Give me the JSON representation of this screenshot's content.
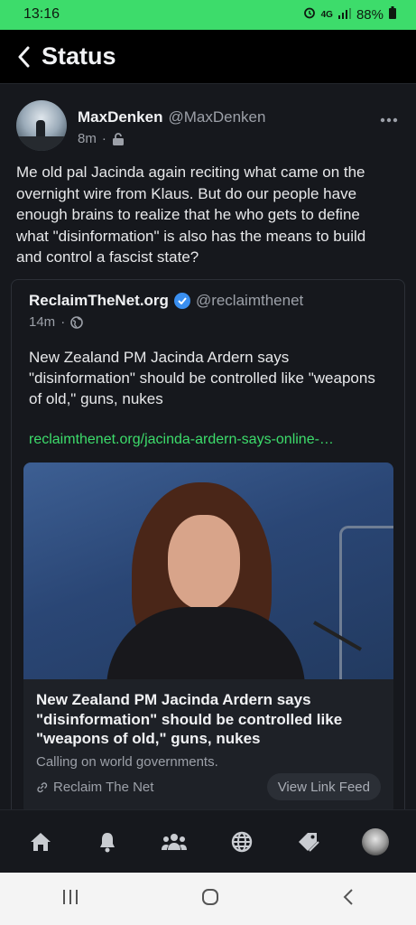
{
  "status_bar": {
    "time": "13:16",
    "battery": "88%"
  },
  "app_bar": {
    "title": "Status"
  },
  "post": {
    "author_name": "MaxDenken",
    "author_handle": "@MaxDenken",
    "time": "8m",
    "body": "Me old pal Jacinda again reciting what came on the overnight wire from Klaus. But do our people have enough brains to realize that he who gets to define what \"disinformation\" is also has the means to build and control a fascist state?"
  },
  "quote": {
    "author_name": "ReclaimTheNet.org",
    "author_handle": "@reclaimthenet",
    "time": "14m",
    "body": "New Zealand PM Jacinda Ardern says \"disinformation\" should be controlled like \"weapons of old,\" guns, nukes",
    "link": "reclaimthenet.org/jacinda-ardern-says-online-…",
    "card": {
      "title": "New Zealand PM Jacinda Ardern says \"disinformation\" should be controlled like \"weapons of old,\" guns, nukes",
      "description": "Calling on world governments.",
      "source": "Reclaim The Net",
      "button": "View Link Feed"
    }
  },
  "tabs": [
    "home-icon",
    "bell-icon",
    "groups-icon",
    "globe-icon",
    "tag-icon",
    "profile-avatar"
  ],
  "colors": {
    "accent": "#3ddc6b",
    "background": "#16181d",
    "verified": "#3a8ff0"
  }
}
